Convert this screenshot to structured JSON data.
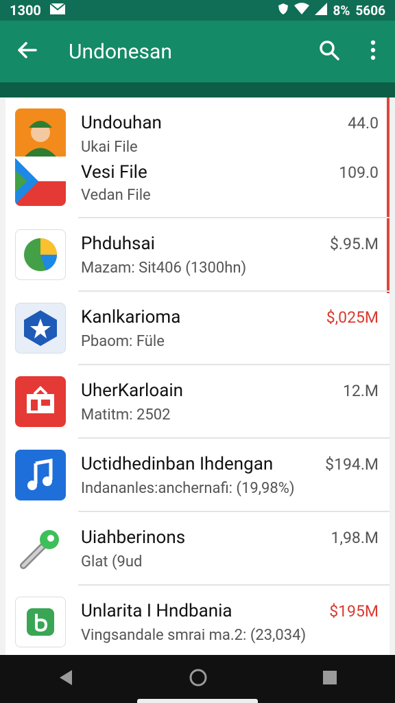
{
  "status_bar": {
    "time": "1300",
    "battery": "8%",
    "extra": "5606"
  },
  "app_bar": {
    "title": "Undonesan"
  },
  "first_item": {
    "title1": "Undouhan",
    "sub1": "Ukai File",
    "value1": "44.0",
    "title2": "Vesi File",
    "sub2": "Vedan File",
    "value2": "109.0"
  },
  "items": [
    {
      "title": "Phduhsai",
      "subtitle": "Mazam: Sit406 (1300hn)",
      "value": "$.95.M",
      "value_color": "#555555"
    },
    {
      "title": "Kanlkarioma",
      "subtitle": "Pbaom: Füle",
      "value": "$,025M",
      "value_color": "#d93a2f"
    },
    {
      "title": "UherKarloain",
      "subtitle": "Matitm: 2502",
      "value": "12.M",
      "value_color": "#555555"
    },
    {
      "title": "Uctidhedinban Ihdengan",
      "subtitle": "Indananles:anchernafi: (19,98%)",
      "value": "$194.M",
      "value_color": "#555555"
    },
    {
      "title": "Uiahberinons",
      "subtitle": "Glat (9ud",
      "value": "1,98.M",
      "value_color": "#555555"
    },
    {
      "title": "Unlarita I Hndbania",
      "subtitle": "Vingsandale smrai ma.2: (23,034)",
      "value": "$195M",
      "value_color": "#d93a2f"
    }
  ]
}
